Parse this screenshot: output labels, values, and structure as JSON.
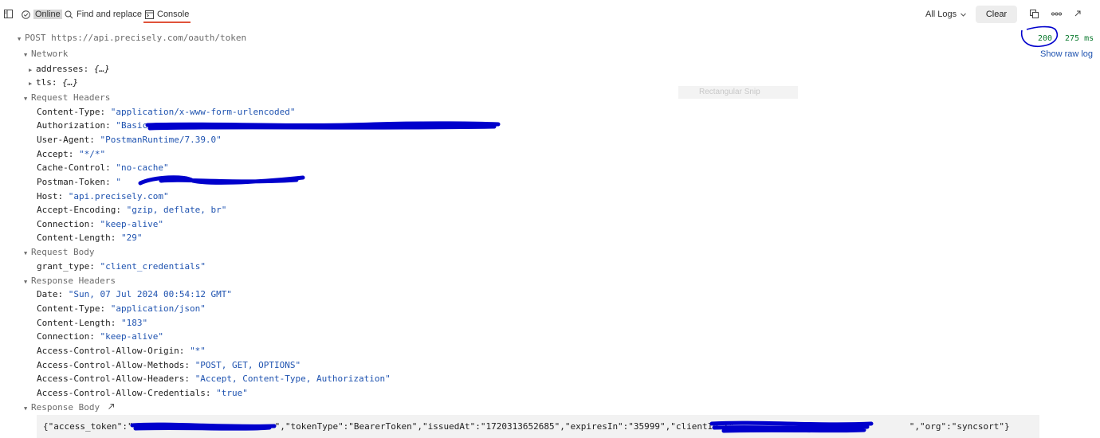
{
  "toolbar": {
    "status_label": "Online",
    "find_replace_label": "Find and replace",
    "console_label": "Console",
    "logs_filter": "All Logs",
    "clear_label": "Clear"
  },
  "request": {
    "method": "POST",
    "url": "https://api.precisely.com/oauth/token",
    "status_code": "200",
    "time": "275 ms",
    "raw_log_label": "Show raw log"
  },
  "overlay": {
    "ghost_label": "Rectangular Snip"
  },
  "network": {
    "label": "Network",
    "addresses_key": "addresses:",
    "addresses_val": "{…}",
    "tls_key": "tls:",
    "tls_val": "{…}"
  },
  "request_headers": {
    "label": "Request Headers",
    "items": [
      {
        "key": "Content-Type:",
        "value": "\"application/x-www-form-urlencoded\""
      },
      {
        "key": "Authorization:",
        "value": "\"Basic"
      },
      {
        "key": "User-Agent:",
        "value": "\"PostmanRuntime/7.39.0\""
      },
      {
        "key": "Accept:",
        "value": "\"*/*\""
      },
      {
        "key": "Cache-Control:",
        "value": "\"no-cache\""
      },
      {
        "key": "Postman-Token:",
        "value": "\""
      },
      {
        "key": "Host:",
        "value": "\"api.precisely.com\""
      },
      {
        "key": "Accept-Encoding:",
        "value": "\"gzip, deflate, br\""
      },
      {
        "key": "Connection:",
        "value": "\"keep-alive\""
      },
      {
        "key": "Content-Length:",
        "value": "\"29\""
      }
    ]
  },
  "request_body": {
    "label": "Request Body",
    "items": [
      {
        "key": "grant_type:",
        "value": "\"client_credentials\""
      }
    ]
  },
  "response_headers": {
    "label": "Response Headers",
    "items": [
      {
        "key": "Date:",
        "value": "\"Sun, 07 Jul 2024 00:54:12 GMT\""
      },
      {
        "key": "Content-Type:",
        "value": "\"application/json\""
      },
      {
        "key": "Content-Length:",
        "value": "\"183\""
      },
      {
        "key": "Connection:",
        "value": "\"keep-alive\""
      },
      {
        "key": "Access-Control-Allow-Origin:",
        "value": "\"*\""
      },
      {
        "key": "Access-Control-Allow-Methods:",
        "value": "\"POST, GET, OPTIONS\""
      },
      {
        "key": "Access-Control-Allow-Headers:",
        "value": "\"Accept, Content-Type, Authorization\""
      },
      {
        "key": "Access-Control-Allow-Credentials:",
        "value": "\"true\""
      }
    ]
  },
  "response_body": {
    "label": "Response Body",
    "text_start": "{\"access_token\":\"",
    "text_mid": "\",\"tokenType\":\"BearerToken\",\"issuedAt\":\"1720313652685\",\"expiresIn\":\"35999\",\"clientID\":\"",
    "text_end": "\",\"org\":\"syncsort\"}"
  },
  "colors": {
    "value_blue": "#1f53b0",
    "success_green": "#0c7a2f",
    "console_underline": "#e0533a",
    "annotation_blue": "#0000cc"
  },
  "icons": [
    "sidebar-icon",
    "check-circle-icon",
    "search-icon",
    "console-icon",
    "chevron-down-icon",
    "copy-icon",
    "more-icon",
    "expand-icon",
    "triangle-down-icon",
    "triangle-right-icon",
    "external-link-icon"
  ]
}
